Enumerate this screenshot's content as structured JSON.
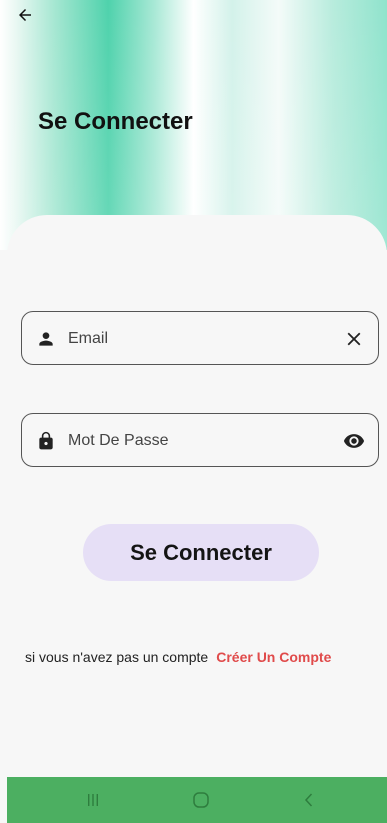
{
  "header": {
    "title": "Se Connecter"
  },
  "form": {
    "email_placeholder": "Email",
    "password_placeholder": "Mot De Passe",
    "submit_label": "Se Connecter"
  },
  "signup": {
    "prompt": "si vous n'avez pas un compte",
    "link_label": "Créer Un Compte"
  },
  "icons": {
    "back": "arrow-left-icon",
    "email_lead": "person-icon",
    "email_trail": "close-icon",
    "password_lead": "lock-icon",
    "password_trail": "eye-icon",
    "nav_recents": "recents-icon",
    "nav_home": "home-icon",
    "nav_back": "chevron-left-icon"
  },
  "colors": {
    "accent_green": "#4caf61",
    "button_bg": "#e6dff6",
    "link": "#e04b4b",
    "header_teal": "#4fd2ac"
  }
}
